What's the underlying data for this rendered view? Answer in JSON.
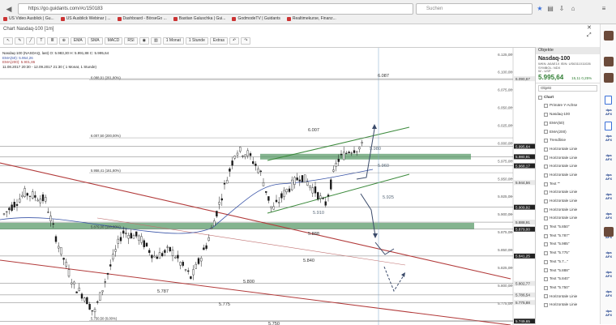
{
  "browser": {
    "url": "https://go.guidants.com/#c/150183",
    "search_placeholder": "Suchen",
    "bookmarks": [
      "US Video Ausblick | Gu...",
      "US Ausblick Webinar | ...",
      "Dashboard - BörseGo ...",
      "Bastian Galuschka | Gui...",
      "GodmodeTV | Guidants",
      "Realtimekurse, Finanz..."
    ]
  },
  "app": {
    "title": "Chart Nasdaq-100 [1m]",
    "toolbar": [
      "EMA",
      "SMA",
      "MACD",
      "RSI",
      "1 Monat",
      "1 Stunde",
      "Extras"
    ]
  },
  "legend": {
    "line1": "Nasdaq-100 (NASDAQ, last)  O: 5.983,30  H: 5.991,88  C: 5.995,64",
    "line2": "EMA(50): 5.954,26",
    "line3": "EMA(200): 5.901,86",
    "line4": "11.08.2017 20:30 - 12.09.2017 21:30  ( 1 Monat, 1 Stunde)"
  },
  "chart_data": {
    "type": "candlestick",
    "y_axis_ticks": [
      "6.125,00",
      "6.100,00",
      "6.075,00",
      "6.050,00",
      "6.025,00",
      "6.000,00",
      "5.975,00",
      "5.950,00",
      "5.925,00",
      "5.900,00",
      "5.875,00",
      "5.850,00",
      "5.825,00",
      "5.800,00",
      "5.775,00"
    ],
    "level_labels": [
      "6.090,67",
      "5.995,64",
      "5.980,91",
      "5.968,17",
      "5.944,56",
      "5.909,92",
      "5.888,91",
      "5.879,00",
      "5.841,25",
      "5.802,77",
      "5.786,54",
      "5.775,88",
      "5.749,65"
    ],
    "fib_labels": [
      "6.088,91 (261,80%)",
      "6.007,50 (200,00%)",
      "5.958,41 (161,80%)",
      "5.879,00 (100,00%)",
      "5.750,50 (0,00%)"
    ],
    "annotations": [
      "6.087",
      "6.007",
      "5.980",
      "5.960",
      "5.925",
      "5.910",
      "5.888",
      "5.840",
      "5.800",
      "5.787",
      "5.775",
      "5.750"
    ]
  },
  "right_panel": {
    "header": "Objekte",
    "symbol": "Nasdaq-100",
    "meta1": "WKN: A0AE1X  ISIN: US6311011026",
    "meta2": "SYMBOL: NDX",
    "meta3": "W - USP",
    "price": "5.995,64",
    "change": "15,11  0,25%",
    "field": "Objekt",
    "tree_root": "Chart",
    "tree_items": [
      "Primäre Y-Achse",
      "Nasdaq-100",
      "EMA(50)",
      "EMA(200)",
      "Trendlinie",
      "Horizontale Linie",
      "Horizontale Linie",
      "Horizontale Linie",
      "Horizontale Linie",
      "Text \"\"",
      "Horizontale Linie",
      "Horizontale Linie",
      "Horizontale Linie",
      "Horizontale Linie",
      "Text \"5.850\"",
      "Text \"5.787\"",
      "Text \"5.985\"",
      "Text \"5.775\"",
      "Text \"5.7...\"",
      "Text \"5.888\"",
      "Text \"5.840\"",
      "Text \"5.750\"",
      "Horizontale Linie",
      "Horizontale Linie"
    ]
  },
  "side": {
    "dpa": "dpa AFX"
  }
}
